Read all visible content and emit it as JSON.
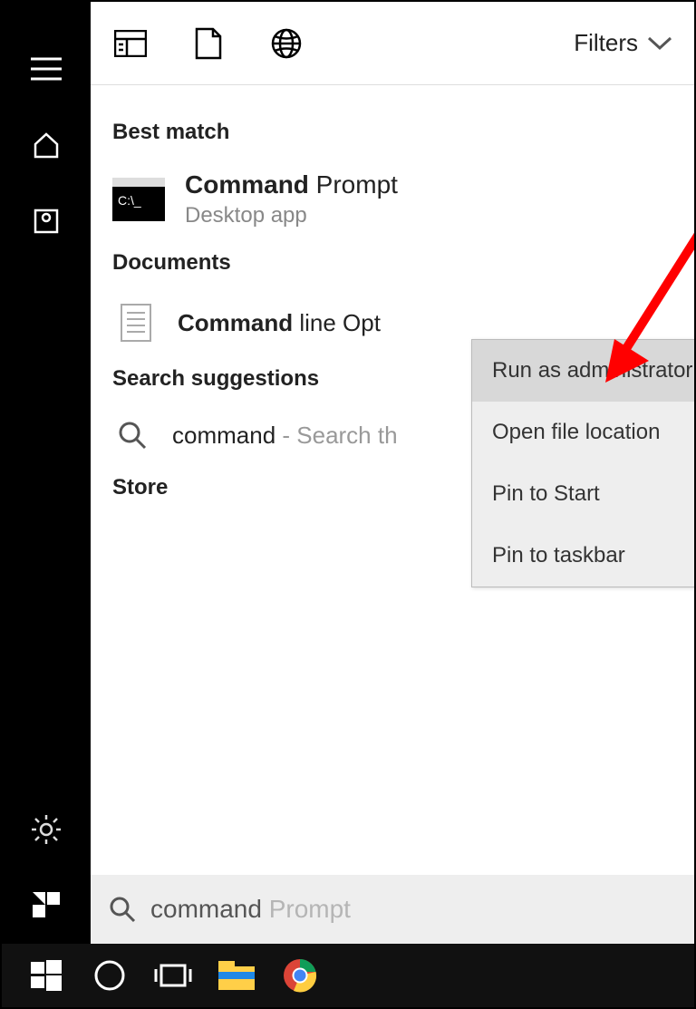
{
  "topbar": {
    "filters_label": "Filters"
  },
  "sections": {
    "best_match": "Best match",
    "documents": "Documents",
    "suggestions": "Search suggestions",
    "store": "Store"
  },
  "results": {
    "command_prompt": {
      "name_bold": "Command",
      "name_rest": " Prompt",
      "subtitle": "Desktop app"
    },
    "doc": {
      "name_bold": "Command",
      "name_rest": " line Opt"
    },
    "suggestion": {
      "term": "command",
      "hint_prefix": " - ",
      "hint": "Search th"
    }
  },
  "context_menu": {
    "items": [
      "Run as administrator",
      "Open file location",
      "Pin to Start",
      "Pin to taskbar"
    ]
  },
  "search": {
    "typed": "command",
    "ghost": " Prompt"
  }
}
